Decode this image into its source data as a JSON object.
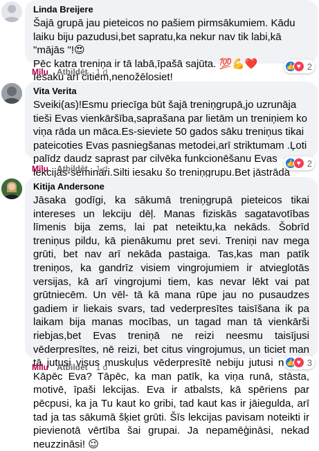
{
  "comments": [
    {
      "author": "Linda Breijere",
      "text": "Šajā grupā jau pieteicos no pašiem pirmsākumiem. Kādu laiku biju pazudusi,bet sapratu,ka nekur nav tik labi,kā \"mājās \"!😍\nPēc katra treniņa ir tā labā,īpašā sajūta. 💯💪❤️\nIesaku arī citiem,nenožēlosiet!",
      "like_label": "Mīlu",
      "reply_label": "Atbildēt",
      "time": "1 d",
      "reaction_count": "2"
    },
    {
      "author": "Vita Verita",
      "text": "Sveiki(as)!Esmu priecīga būt šajā treniņgrupā,jo uzrunāja tieši Evas vienkāršība,saprašana par lietām un treniņiem ko viņa rāda un māca.Es-sieviete 50 gados sāku treniņus tikai pateicoties Evas pasniegšanas metodei,arī striktumam .Ļoti palīdz daudz saprast par cilvēka funkcionēšanu Evas lekcijas-semināri.Silti iesaku šo treniņgrupu.Bet jāstrādā būs pašiem...",
      "like_label": "Mīlu",
      "reply_label": "Atbildēt",
      "time": "1 d",
      "reaction_count": "2"
    },
    {
      "author": "Kitija Andersone",
      "text": "Jāsaka godīgi, ka sākumā treniņgrupā pieteicos tikai intereses un lekciju dēļ. Manas fiziskās sagatavotības līmenis bija zems, lai pat neteiktu,ka nekāds. Šobrīd treniņus pildu, kā pienākumu pret sevi. Treniņi nav mega grūti, bet nav arī nekāda pastaiga. Tas,kas man patīk treniņos, ka gandrīz visiem vingrojumiem ir atvieglotās versijas, kā arī vingrojumi tiem, kas nevar lēkt vai pat grūtniecēm. Un vēl- tā kā mana rūpe jau no pusaudzes gadiem ir liekais svars, tad vederpresītes taisīšana ik pa laikam bija manas mocības, un tagad man tā vienkārši riebjas,bet Evas treniņā ne reizi neesmu taisījusi vēderpresītes, nē reizi, bet citus vingrojumus, un ticiet man tā jutusi visus muskuļus vēderpresītē nebiju jutusi nekad! Kāpēc Eva? Tāpēc, ka man patīk, ka viņa runā, stāsta, motivē, īpaši lekcijas. Eva ir atbalsts, kā spēriens par pēcpusi, ka ja Tu kaut ko gribi, tad kaut kas ir jāiegulda, arī tad ja tas sākumā šķiet grūti. Šīs lekcijas pavisam noteikti ir pievienotā vērtība šai grupai. Ja nepamēģināsi, nekad neuzzināsi! 😉",
      "like_label": "Mīlu",
      "reply_label": "Atbildēt",
      "time": "1 d",
      "reaction_count": "3"
    }
  ],
  "colors": {
    "bubble": "#f0f2f5",
    "like_text": "#b0004a",
    "meta_text": "#65676b",
    "like_reaction": "#1877f2",
    "love_reaction": "#f33e58"
  }
}
